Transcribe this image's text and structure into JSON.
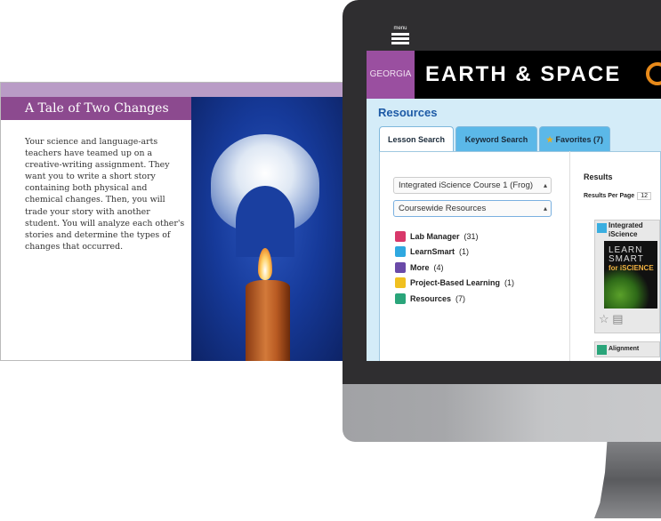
{
  "card": {
    "title": "A Tale of Two Changes",
    "body": "Your science and language-arts teachers have teamed up on a creative-writing assignment. They want you to write a short story containing both physical and chemical changes. Then, you will trade your story with another student. You will analyze each other's stories and determine the types of changes that occurred."
  },
  "app": {
    "menu_label": "menu",
    "state": "GEORGIA",
    "brand": "EARTH & SPACE",
    "section_title": "Resources",
    "tabs": [
      {
        "label": "Lesson Search"
      },
      {
        "label": "Keyword Search"
      },
      {
        "label": "Favorites (7)"
      }
    ],
    "course_select": "Integrated iScience Course 1 (Frog)",
    "resource_select": "Coursewide Resources",
    "categories": [
      {
        "label": "Lab Manager",
        "count": "(31)",
        "color": "#d8386a"
      },
      {
        "label": "LearnSmart",
        "count": "(1)",
        "color": "#2fa8e0"
      },
      {
        "label": "More",
        "count": "(4)",
        "color": "#6a4aa8"
      },
      {
        "label": "Project-Based Learning",
        "count": "(1)",
        "color": "#f0c020"
      },
      {
        "label": "Resources",
        "count": "(7)",
        "color": "#2aa57a"
      }
    ],
    "results_label": "Results",
    "results_per_page_label": "Results Per Page",
    "results_per_page": "12",
    "tiles": [
      {
        "title": "Integrated iScience",
        "image_text": "LEARN SMART",
        "image_sub": "for iSCIENCE"
      },
      {
        "title": "Alignment"
      }
    ]
  },
  "colors": {
    "accent_purple": "#8c4a8f",
    "accent_blue": "#1d5aa6",
    "tab_blue": "#5bb8e8"
  }
}
